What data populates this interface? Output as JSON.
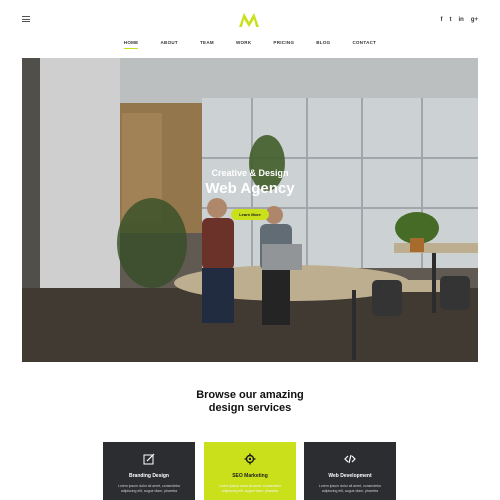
{
  "header": {
    "nav": [
      "HOME",
      "ABOUT",
      "TEAM",
      "WORK",
      "PRICING",
      "BLOG",
      "CONTACT"
    ],
    "active_nav": "HOME",
    "social": [
      "f",
      "t",
      "in",
      "g+"
    ]
  },
  "hero": {
    "subtitle": "Creative & Design",
    "title": "Web Agency",
    "button": "Learn More"
  },
  "services": {
    "heading_line1": "Browse our amazing",
    "heading_line2": "design services",
    "cards": [
      {
        "title": "Branding Design",
        "desc": "Lorem ipsum dolor sit amet, consectetur adipiscing elit, augue diam, pharetra",
        "icon": "edit-icon"
      },
      {
        "title": "SEO Marketing",
        "desc": "Lorem ipsum dolor sit amet, consectetur adipiscing elit, augue diam, pharetra",
        "icon": "gear-icon"
      },
      {
        "title": "Web Development",
        "desc": "Lorem ipsum dolor sit amet, consectetur adipiscing elit, augue diam, pharetra",
        "icon": "code-icon"
      }
    ]
  },
  "colors": {
    "accent": "#c9e01a",
    "dark": "#2c2d31"
  }
}
